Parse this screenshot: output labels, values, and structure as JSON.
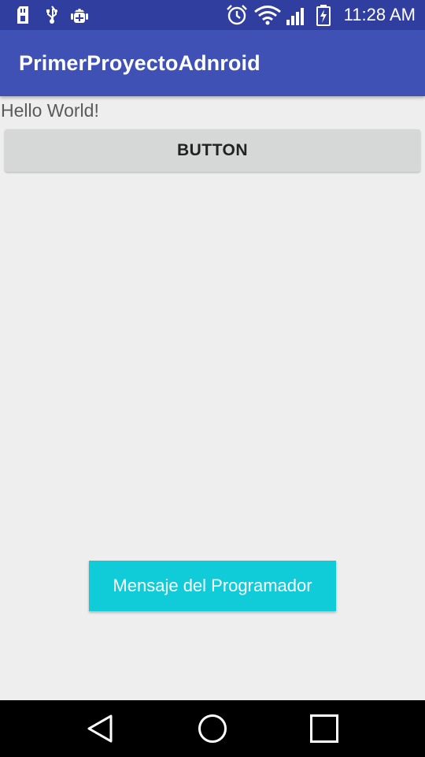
{
  "status_bar": {
    "time": "11:28 AM",
    "icons": [
      "sd-card-icon",
      "usb-icon",
      "android-debug-icon",
      "alarm-icon",
      "wifi-icon",
      "signal-icon",
      "battery-charging-icon"
    ]
  },
  "app_bar": {
    "title": "PrimerProyectoAdnroid"
  },
  "content": {
    "hello_text": "Hello World!",
    "button_label": "BUTTON",
    "dev_button_label": "Mensaje del Programador"
  },
  "nav_bar": {
    "icons": [
      "back-icon",
      "home-icon",
      "recents-icon"
    ]
  },
  "colors": {
    "status_bar": "#303f9f",
    "app_bar": "#3f51b5",
    "background": "#eeeeee",
    "button_gray": "#d6d7d7",
    "accent_cyan": "#10cbd8",
    "nav_bar": "#000000"
  }
}
